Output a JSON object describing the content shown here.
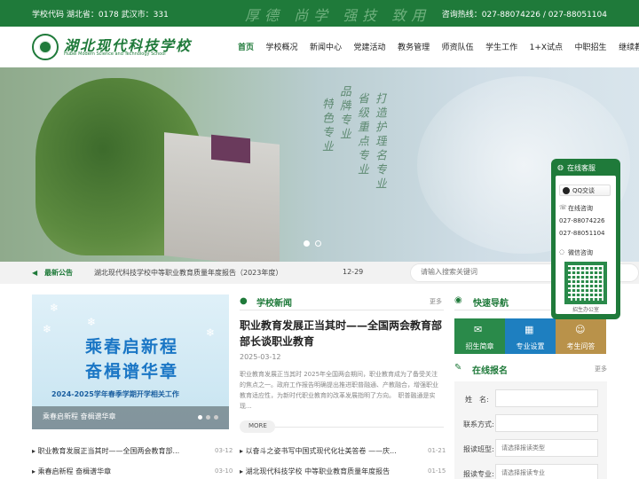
{
  "topbar": {
    "codes": "学校代码 湖北省：0178 武汉市：331",
    "motto": "厚德 尚学 强技 致用",
    "hotline": "咨询热线：027-88074226 / 027-88051104"
  },
  "header": {
    "logo_cn": "湖北现代科技学校",
    "logo_en": "Hubei Modern Science and Technology School",
    "nav": [
      "首页",
      "学校概况",
      "新闻中心",
      "党建活动",
      "教务管理",
      "师资队伍",
      "学生工作",
      "1+X试点",
      "中职招生",
      "继续教育"
    ]
  },
  "banner": {
    "slogan_cols": [
      "打造护理名专业",
      "省级重点专业",
      "品牌专业",
      "特色专业"
    ],
    "slide_count": 2,
    "active_slide": 1
  },
  "notice": {
    "label": "最新公告",
    "text": "湖北现代科技学校中等职业教育质量年度报告（2023年度）",
    "date": "12-29"
  },
  "search": {
    "placeholder": "请输入搜索关键词"
  },
  "promo": {
    "line1": "乘春启新程",
    "line2": "奋楫谱华章",
    "line3": "2024-2025学年春季学期开学相关工作",
    "caption": "乘春启新程 奋楫谱华章"
  },
  "school_news": {
    "title": "学校新闻",
    "more": "更多",
    "headline": "职业教育发展正当其时——全国两会教育部部长谈职业教育",
    "date": "2025-03-12",
    "summary": "职业教育发展正当其时 2025年全国两会期间，职业教育成为了备受关注的焦点之一。政府工作报告明确提出推进职普融通、产教融合，增强职业教育适应性，为新时代职业教育的改革发展指明了方向。　职普融通是实现...",
    "more_btn": "MORE"
  },
  "left_list": [
    {
      "text": "职业教育发展正当其时——全国两会教育部...",
      "date": "03-12"
    },
    {
      "text": "乘春启新程 奋楫谱华章",
      "date": "03-10"
    }
  ],
  "mid_list": [
    {
      "text": "以奋斗之姿书写中国式现代化壮美答卷 ——庆...",
      "date": "01-21"
    },
    {
      "text": "湖北现代科技学校 中等职业教育质量年度报告",
      "date": "01-15"
    }
  ],
  "quick_nav": {
    "title": "快速导航",
    "items": [
      {
        "label": "招生简章",
        "icon": "✉",
        "color": "#2a8a4a"
      },
      {
        "label": "专业设置",
        "icon": "▦",
        "color": "#1e7fc0"
      },
      {
        "label": "考生问答",
        "icon": "☺",
        "color": "#b9924a"
      }
    ]
  },
  "apply": {
    "title": "在线报名",
    "more": "更多",
    "fields": [
      {
        "label": "姓　名:",
        "placeholder": ""
      },
      {
        "label": "联系方式:",
        "placeholder": ""
      },
      {
        "label": "报读班型:",
        "placeholder": "请选择报读类型"
      },
      {
        "label": "报读专业:",
        "placeholder": "请选择报读专业"
      }
    ]
  },
  "service": {
    "title": "在线客服",
    "qq": "QQ交谈",
    "consult": "在线咨询",
    "phones": [
      "027-88074226",
      "027-88051104"
    ],
    "wechat": "微信咨询",
    "qr_label": "招生办公室"
  }
}
